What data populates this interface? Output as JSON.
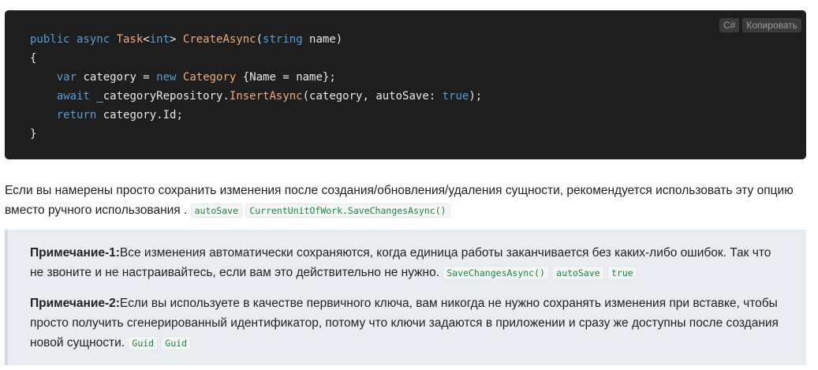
{
  "code_block": {
    "language": "C#",
    "copy_label": "Копировать",
    "lines": [
      [
        {
          "t": "public async ",
          "c": "kw"
        },
        {
          "t": "Task",
          "c": "cls"
        },
        {
          "t": "<",
          "c": "txt"
        },
        {
          "t": "int",
          "c": "kw"
        },
        {
          "t": "> ",
          "c": "txt"
        },
        {
          "t": "CreateAsync",
          "c": "fnc"
        },
        {
          "t": "(",
          "c": "txt"
        },
        {
          "t": "string",
          "c": "kw"
        },
        {
          "t": " name)",
          "c": "txt"
        }
      ],
      [
        {
          "t": "{",
          "c": "txt"
        }
      ],
      [
        {
          "t": "    ",
          "c": "txt"
        },
        {
          "t": "var",
          "c": "kw"
        },
        {
          "t": " category = ",
          "c": "txt"
        },
        {
          "t": "new",
          "c": "kw"
        },
        {
          "t": " ",
          "c": "txt"
        },
        {
          "t": "Category",
          "c": "cls"
        },
        {
          "t": " {Name = name};",
          "c": "txt"
        }
      ],
      [
        {
          "t": "    ",
          "c": "txt"
        },
        {
          "t": "await",
          "c": "kw"
        },
        {
          "t": " _categoryRepository.",
          "c": "txt"
        },
        {
          "t": "InsertAsync",
          "c": "fnc"
        },
        {
          "t": "(category, autoSave: ",
          "c": "txt"
        },
        {
          "t": "true",
          "c": "lit"
        },
        {
          "t": ");",
          "c": "txt"
        }
      ],
      [
        {
          "t": "    ",
          "c": "txt"
        },
        {
          "t": "return",
          "c": "kw"
        },
        {
          "t": " category.Id;",
          "c": "txt"
        }
      ],
      [
        {
          "t": "}",
          "c": "txt"
        }
      ]
    ]
  },
  "paragraph": {
    "text": "Если вы намерены просто сохранить изменения после создания/обновления/удаления сущности, рекомендуется использовать эту опцию вместо ручного использования .",
    "codes": [
      "autoSave",
      "CurrentUnitOfWork.SaveChangesAsync()"
    ]
  },
  "note1": {
    "label": "Примечание-1:",
    "text": "Все изменения автоматически сохраняются, когда единица работы заканчивается без каких-либо ошибок. Так что не звоните и не настраивайтесь, если вам это действительно не нужно.",
    "codes": [
      "SaveChangesAsync()",
      "autoSave",
      "true"
    ]
  },
  "note2": {
    "label": "Примечание-2:",
    "text": "Если вы используете в качестве первичного ключа, вам никогда не нужно сохранять изменения при вставке, чтобы просто получить сгенерированный идентификатор, потому что ключи задаются в приложении и сразу же доступны после создания новой сущности.",
    "codes": [
      "Guid",
      "Guid"
    ]
  }
}
